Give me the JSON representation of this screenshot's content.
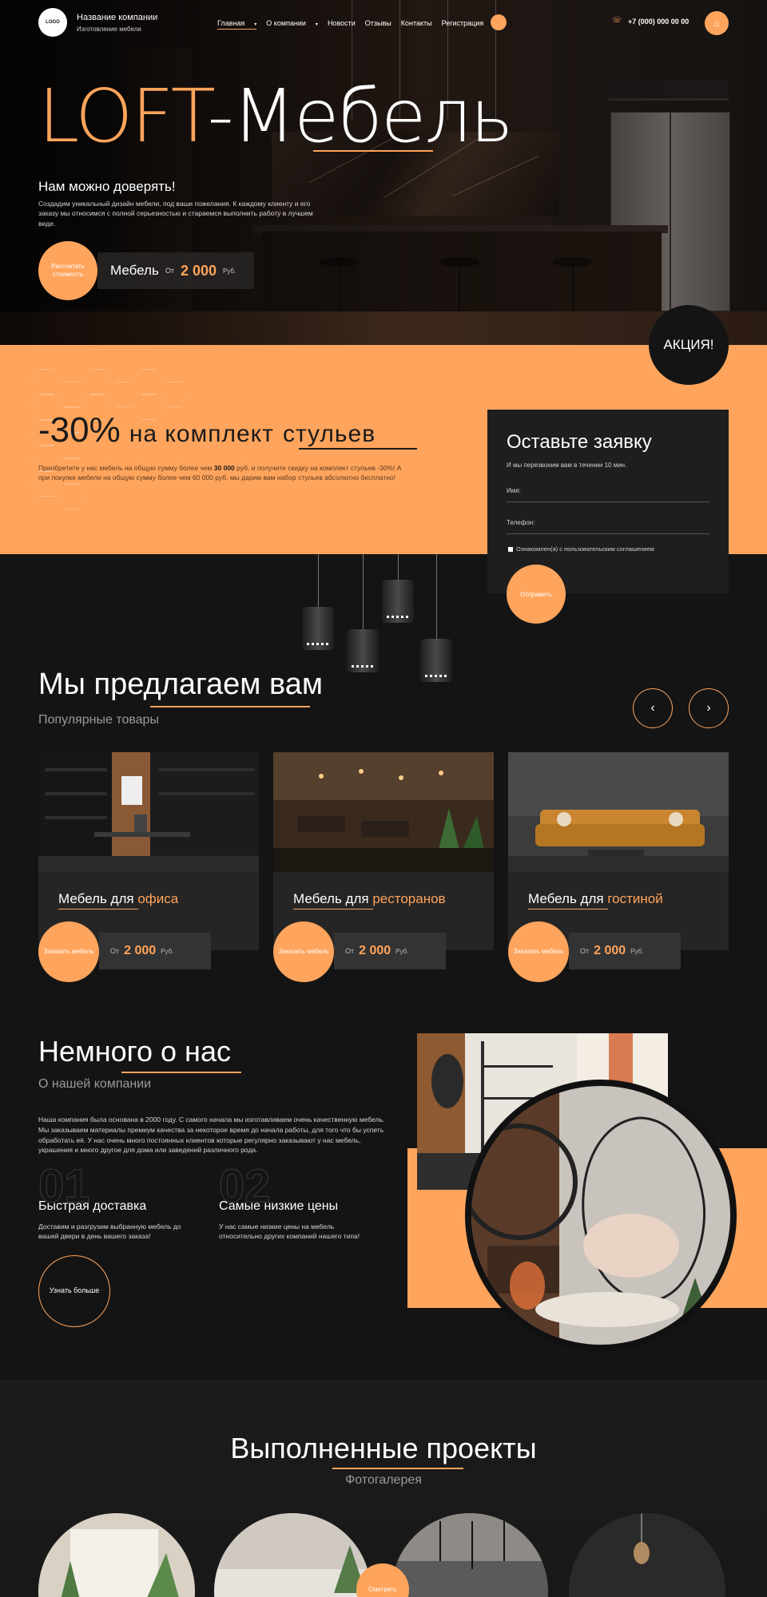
{
  "header": {
    "logo": "LOGO",
    "company_name": "Название компании",
    "company_sub": "Изготовление мебели",
    "nav": [
      {
        "label": "Главная",
        "has_caret": true,
        "active": true
      },
      {
        "label": "О компании",
        "has_caret": true,
        "active": false
      },
      {
        "label": "Новости"
      },
      {
        "label": "Отзывы"
      },
      {
        "label": "Контакты"
      },
      {
        "label": "Регистрация"
      }
    ],
    "phone": "+7 (000) 000 00 00",
    "phone_icon": "phone-icon",
    "cart_icon": "cart-icon"
  },
  "hero": {
    "title_accent": "LOFT",
    "title_rest": "-Мебель",
    "subtitle": "Нам можно доверять!",
    "text": "Создадим уникальный дизайн мебели, под ваши пожелания. К каждому клиенту и его заказу мы относимся с полной серьезностью и стараемся выполнить работу в лучшем виде.",
    "calc_button": "Рассчитать стоимость",
    "price_label": "Мебель",
    "price_from": "От",
    "price_value": "2 000",
    "price_currency": "Руб."
  },
  "promo": {
    "badge": "АКЦИЯ!",
    "discount": "-30%",
    "title_mid": "на комплект",
    "title_end": "стульев",
    "text_part1": "Приобретите у нас мебель на общую сумму более чем ",
    "text_bold": "30 000",
    "text_part2": " руб. и получите скидку на комплект стульев -30%! А при покупке мебели на общую сумму более чем 60 000 руб. мы дарим вам набор стульев абсолютно бесплатно!"
  },
  "form": {
    "title": "Оставьте заявку",
    "subtitle": "И мы перезвоним вам в течении 10 мин.",
    "name_label": "Имя:",
    "phone_label": "Телефон:",
    "consent": "Ознакомлен(а) с пользовательским соглашением",
    "submit": "Отправить"
  },
  "offer": {
    "title": "Мы предлагаем вам",
    "subtitle": "Популярные товары",
    "prev_icon": "‹",
    "next_icon": "›",
    "cards": [
      {
        "cap_prefix": "Мебель для",
        "cap_accent": "офиса",
        "order": "Заказать мебель",
        "from": "От",
        "price": "2 000",
        "currency": "Руб."
      },
      {
        "cap_prefix": "Мебель для",
        "cap_accent": "ресторанов",
        "order": "Заказать мебель",
        "from": "От",
        "price": "2 000",
        "currency": "Руб."
      },
      {
        "cap_prefix": "Мебель для",
        "cap_accent": "гостиной",
        "order": "Заказать мебель",
        "from": "От",
        "price": "2 000",
        "currency": "Руб."
      }
    ]
  },
  "about": {
    "title": "Немного о нас",
    "subtitle": "О нашей компании",
    "text": "Наша компания была основана в 2000 году. С самого начала мы изготавливаем очень качественную мебель. Мы заказываем материалы премиум качества за некоторое время до начала работы, для того что бы успеть обработать её. У нас очень много постоянных клиентов которые регулярно заказывают у нас мебель, украшения и много другое для дома или заведений различного рода.",
    "features": [
      {
        "num": "01",
        "title": "Быстрая доставка",
        "text": "Доставим и разгрузим выбранную мебель до вашей двери в день вашего заказа!"
      },
      {
        "num": "02",
        "title": "Самые низкие цены",
        "text": "У нас самые низкие цены на мебель относительно других компаний нашего типа!"
      }
    ],
    "more_button": "Узнать больше"
  },
  "projects": {
    "title": "Выполненные проекты",
    "subtitle": "Фотогалерея",
    "look_button": "Смотреть"
  },
  "colors": {
    "accent": "#ffa45c",
    "bg": "#141414",
    "panel": "#1e1e1e"
  }
}
